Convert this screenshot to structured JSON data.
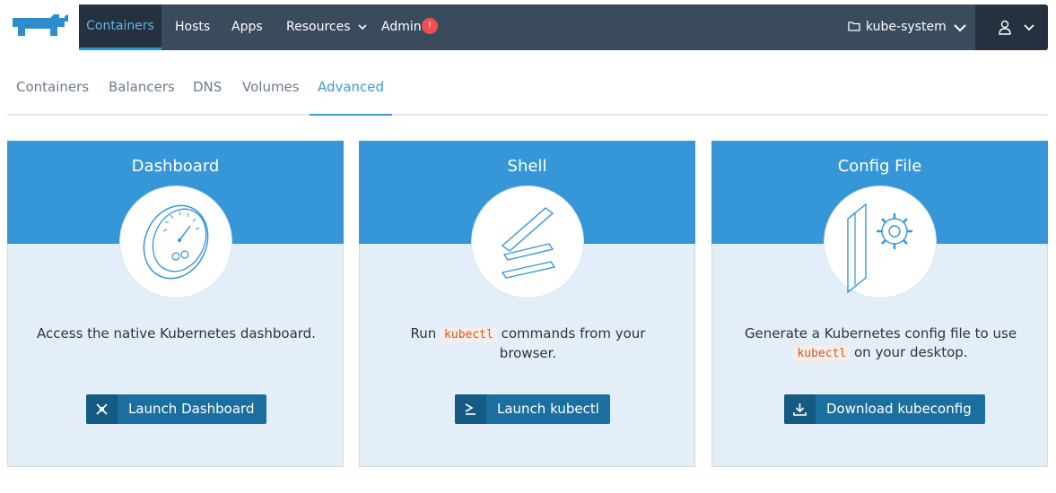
{
  "nav": {
    "items": [
      {
        "label": "Containers"
      },
      {
        "label": "Hosts"
      },
      {
        "label": "Apps"
      },
      {
        "label": "Resources"
      },
      {
        "label": "Admin"
      }
    ],
    "admin_badge": "!",
    "environment": "kube-system",
    "active_item": "Containers"
  },
  "subtabs": {
    "items": [
      {
        "label": "Containers"
      },
      {
        "label": "Balancers"
      },
      {
        "label": "DNS"
      },
      {
        "label": "Volumes"
      },
      {
        "label": "Advanced"
      }
    ],
    "active_item": "Advanced"
  },
  "cards": [
    {
      "title": "Dashboard",
      "desc_text": "Access the native Kubernetes dashboard.",
      "button_label": "Launch Dashboard",
      "illustration": "dashboard-gauge-icon",
      "button_icon": "dashboard-icon"
    },
    {
      "title": "Shell",
      "desc_pre": "Run ",
      "desc_code": "kubectl",
      "desc_post": " commands from your browser.",
      "button_label": "Launch kubectl",
      "illustration": "shell-prompt-icon",
      "button_icon": "terminal-icon"
    },
    {
      "title": "Config File",
      "desc_pre": "Generate a Kubernetes config file to use ",
      "desc_code": "kubectl",
      "desc_post": " on your desktop.",
      "button_label": "Download kubeconfig",
      "illustration": "config-file-gear-icon",
      "button_icon": "download-icon"
    }
  ],
  "colors": {
    "topbar": "#3a4b5c",
    "active_nav_bg": "#25313e",
    "accent": "#3a9bd8",
    "card_header": "#3596d8",
    "card_body": "#e3eef8",
    "button": "#1b6f9e",
    "badge": "#ee4f4f",
    "code_text": "#d8542a"
  }
}
